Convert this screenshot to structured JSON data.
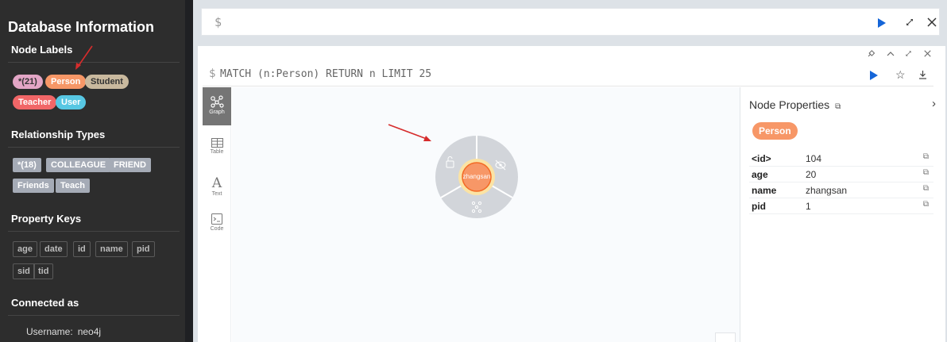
{
  "sidebar": {
    "title": "Database Information",
    "node_labels": {
      "heading": "Node Labels",
      "items": [
        {
          "label": "*(21)",
          "color": "#e3a6c6",
          "text_color": "#333333"
        },
        {
          "label": "Person",
          "color": "#f79767",
          "text_color": "#ffffff"
        },
        {
          "label": "Student",
          "color": "#c9b99e",
          "text_color": "#333333"
        },
        {
          "label": "Teacher",
          "color": "#f16667",
          "text_color": "#ffffff"
        },
        {
          "label": "User",
          "color": "#57c7e3",
          "text_color": "#ffffff"
        }
      ]
    },
    "relationship_types": {
      "heading": "Relationship Types",
      "items": [
        "*(18)",
        "COLLEAGUE",
        "FRIEND",
        "Friends",
        "Teach"
      ]
    },
    "property_keys": {
      "heading": "Property Keys",
      "items": [
        "age",
        "date",
        "id",
        "name",
        "pid",
        "sid",
        "tid"
      ]
    },
    "connected_as": {
      "heading": "Connected as",
      "username_label": "Username:",
      "username": "neo4j"
    }
  },
  "editor": {
    "prompt": "$",
    "value": ""
  },
  "frame": {
    "prompt": "$",
    "query": "MATCH (n:Person) RETURN n LIMIT 25",
    "tabs": [
      {
        "label": "Graph",
        "active": true
      },
      {
        "label": "Table",
        "active": false
      },
      {
        "label": "Text",
        "active": false
      },
      {
        "label": "Code",
        "active": false
      }
    ]
  },
  "graph": {
    "node": {
      "caption": "zhangsan",
      "color": "#f79767",
      "ring_color": "#fbe3a4"
    },
    "menu_color": "#d2d5da"
  },
  "properties": {
    "title": "Node Properties",
    "label": "Person",
    "rows": [
      {
        "key": "<id>",
        "value": "104"
      },
      {
        "key": "age",
        "value": "20"
      },
      {
        "key": "name",
        "value": "zhangsan"
      },
      {
        "key": "pid",
        "value": "1"
      }
    ]
  },
  "colors": {
    "sidebar_bg": "#2d2d2d",
    "accent": "#1565d8",
    "annotation_arrow": "#d62c2c"
  }
}
